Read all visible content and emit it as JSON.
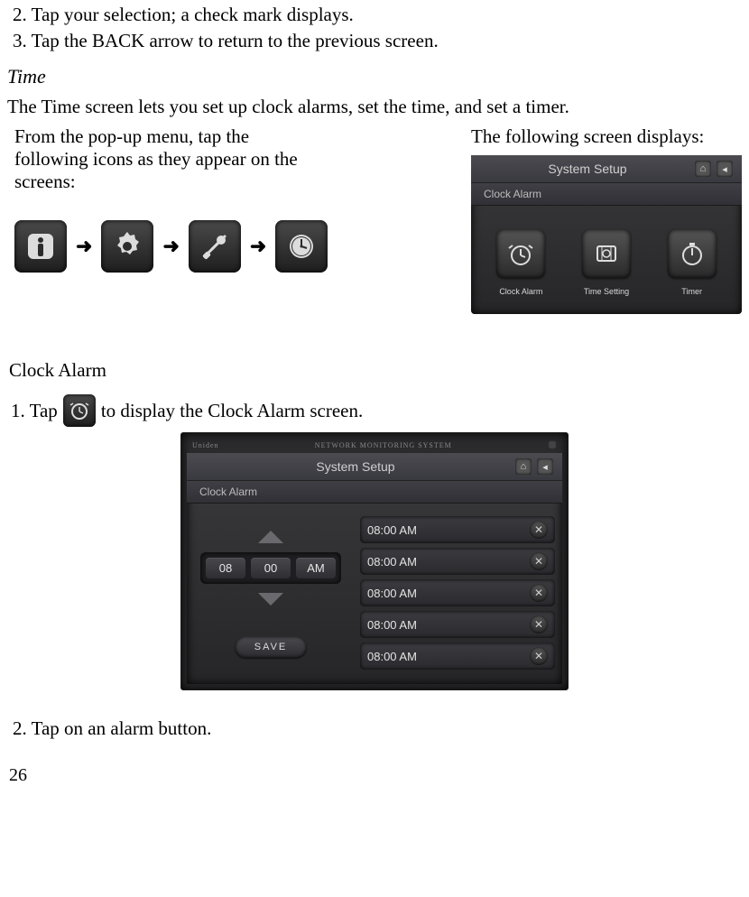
{
  "steps_top": {
    "s2": "2. Tap your selection; a check mark displays.",
    "s3": "3. Tap the BACK arrow to return to the previous screen."
  },
  "section_time_heading": "Time",
  "time_intro": "The Time screen lets you set up clock alarms, set the time, and set a timer.",
  "left_instr": "From the pop-up menu, tap the following icons as they appear on the screens:",
  "right_intro": "The following screen displays:",
  "arrow_glyph": "➜",
  "device1": {
    "title": "System Setup",
    "subtitle": "Clock Alarm",
    "items": [
      {
        "label": "Clock Alarm"
      },
      {
        "label": "Time Setting"
      },
      {
        "label": "Timer"
      }
    ]
  },
  "clock_alarm_heading": "Clock Alarm",
  "step1_pre": "1. Tap",
  "step1_post": "to display the Clock Alarm screen.",
  "device2": {
    "brand": "Uniden",
    "tagline": "NETWORK MONITORING SYSTEM",
    "title": "System Setup",
    "subtitle": "Clock Alarm",
    "picker": {
      "hh": "08",
      "mm": "00",
      "ampm": "AM"
    },
    "save": "SAVE",
    "alarms": [
      {
        "t": "08:00 AM"
      },
      {
        "t": "08:00 AM"
      },
      {
        "t": "08:00 AM"
      },
      {
        "t": "08:00 AM"
      },
      {
        "t": "08:00 AM"
      }
    ]
  },
  "step2": "2. Tap on an alarm button.",
  "page_number": "26"
}
